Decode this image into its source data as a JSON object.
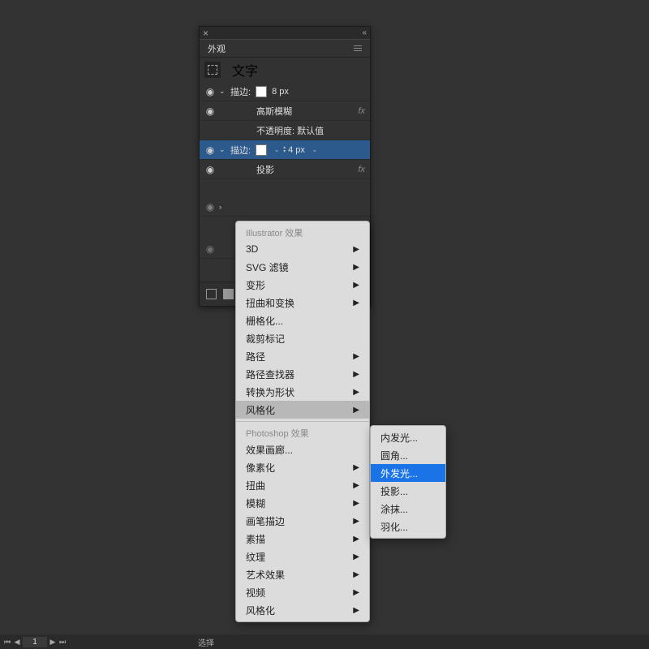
{
  "panel": {
    "title": "外观",
    "object_type": "文字",
    "rows": [
      {
        "id": "stroke1",
        "label": "描边:",
        "value": "8 px",
        "eye": true,
        "chev": "down",
        "swatch": "#fff"
      },
      {
        "id": "gauss",
        "label": "高斯模糊",
        "fx": true,
        "eye": true,
        "indent": 2
      },
      {
        "id": "opacity1",
        "label": "不透明度: 默认值",
        "indent": 2
      },
      {
        "id": "stroke2",
        "label": "描边:",
        "value": "4 px",
        "eye": true,
        "chev": "down",
        "swatch_dd": true,
        "sel": true
      },
      {
        "id": "shadow",
        "label": "投影",
        "fx": true,
        "eye": true,
        "indent": 2
      }
    ]
  },
  "menu_main": {
    "section1_header": "Illustrator 效果",
    "section1": [
      {
        "label": "3D",
        "sub": true
      },
      {
        "label": "SVG 滤镜",
        "sub": true
      },
      {
        "label": "变形",
        "sub": true
      },
      {
        "label": "扭曲和变换",
        "sub": true
      },
      {
        "label": "栅格化..."
      },
      {
        "label": "裁剪标记"
      },
      {
        "label": "路径",
        "sub": true
      },
      {
        "label": "路径查找器",
        "sub": true
      },
      {
        "label": "转换为形状",
        "sub": true
      },
      {
        "label": "风格化",
        "sub": true,
        "hover": true
      }
    ],
    "section2_header": "Photoshop 效果",
    "section2": [
      {
        "label": "效果画廊..."
      },
      {
        "label": "像素化",
        "sub": true
      },
      {
        "label": "扭曲",
        "sub": true
      },
      {
        "label": "模糊",
        "sub": true
      },
      {
        "label": "画笔描边",
        "sub": true
      },
      {
        "label": "素描",
        "sub": true
      },
      {
        "label": "纹理",
        "sub": true
      },
      {
        "label": "艺术效果",
        "sub": true
      },
      {
        "label": "视频",
        "sub": true
      },
      {
        "label": "风格化",
        "sub": true
      }
    ]
  },
  "menu_sub": [
    {
      "label": "内发光..."
    },
    {
      "label": "圆角..."
    },
    {
      "label": "外发光...",
      "sel": true
    },
    {
      "label": "投影..."
    },
    {
      "label": "涂抹..."
    },
    {
      "label": "羽化..."
    }
  ],
  "bottom": {
    "page": "1",
    "status": "选择"
  }
}
